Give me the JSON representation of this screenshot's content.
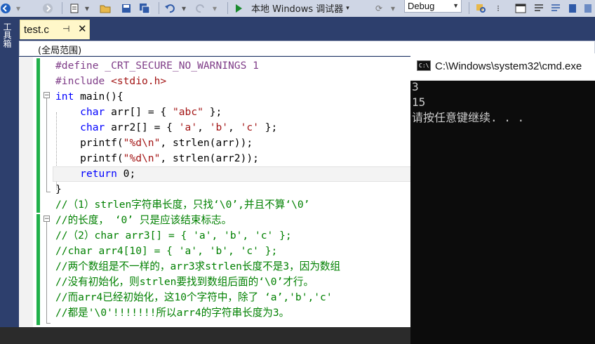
{
  "toolbar": {
    "debugger_label": "本地 Windows 调试器",
    "config_value": "Debug"
  },
  "left_panel": {
    "toolbox_label": "工具箱"
  },
  "editor": {
    "tab": {
      "name": "test.c",
      "pin": "⊣",
      "close": "✕"
    },
    "scope": "(全局范围)",
    "lines": [
      [
        {
          "t": "#define _CRT_SECURE_NO_WARNINGS 1",
          "c": "pp"
        }
      ],
      [
        {
          "t": "#include ",
          "c": "pp"
        },
        {
          "t": "<stdio.h>",
          "c": "str"
        }
      ],
      [
        {
          "t": "int",
          "c": "kw"
        },
        {
          "t": " main(){",
          "c": ""
        }
      ],
      [
        {
          "t": "    ",
          "c": ""
        },
        {
          "t": "char",
          "c": "kw"
        },
        {
          "t": " arr[] = { ",
          "c": ""
        },
        {
          "t": "\"abc\"",
          "c": "str"
        },
        {
          "t": " };",
          "c": ""
        }
      ],
      [
        {
          "t": "    ",
          "c": ""
        },
        {
          "t": "char",
          "c": "kw"
        },
        {
          "t": " arr2[] = { ",
          "c": ""
        },
        {
          "t": "'a'",
          "c": "str"
        },
        {
          "t": ", ",
          "c": ""
        },
        {
          "t": "'b'",
          "c": "str"
        },
        {
          "t": ", ",
          "c": ""
        },
        {
          "t": "'c'",
          "c": "str"
        },
        {
          "t": " };",
          "c": ""
        }
      ],
      [
        {
          "t": "    printf(",
          "c": ""
        },
        {
          "t": "\"%d\\n\"",
          "c": "str"
        },
        {
          "t": ", strlen(arr));",
          "c": ""
        }
      ],
      [
        {
          "t": "    printf(",
          "c": ""
        },
        {
          "t": "\"%d\\n\"",
          "c": "str"
        },
        {
          "t": ", strlen(arr2));",
          "c": ""
        }
      ],
      [
        {
          "t": "    ",
          "c": ""
        },
        {
          "t": "return",
          "c": "kw"
        },
        {
          "t": " 0;",
          "c": ""
        }
      ],
      [
        {
          "t": "}",
          "c": ""
        }
      ],
      [
        {
          "t": "//（1）strlen字符串长度，只找‘\\0’,并且不算‘\\0’",
          "c": "cmt"
        }
      ],
      [
        {
          "t": "//的长度， ‘0’ 只是应该结束标志。",
          "c": "cmt"
        }
      ],
      [
        {
          "t": "//（2）char arr3[] = { 'a', 'b', 'c' };",
          "c": "cmt"
        }
      ],
      [
        {
          "t": "//char arr4[10] = { 'a', 'b', 'c' };",
          "c": "cmt"
        }
      ],
      [
        {
          "t": "//两个数组是不一样的，arr3求strlen长度不是3，因为数组",
          "c": "cmt"
        }
      ],
      [
        {
          "t": "//没有初始化，则strlen要找到数组后面的‘\\0’才行。",
          "c": "cmt"
        }
      ],
      [
        {
          "t": "//而arr4已经初始化，这10个字符中，除了 ‘a’,'b','c'",
          "c": "cmt"
        }
      ],
      [
        {
          "t": "//都是'\\0'!!!!!!!所以arr4的字符串长度为3。",
          "c": "cmt"
        }
      ]
    ]
  },
  "console": {
    "title": "C:\\Windows\\system32\\cmd.exe",
    "icon": "C:\\",
    "output": [
      "3",
      "15",
      "请按任意键继续. . ."
    ]
  },
  "colors": {
    "preprocessor": "#7f3d88",
    "string": "#a31515",
    "keyword": "#0000ff",
    "comment": "#008000",
    "change_bar": "#21b14b"
  }
}
